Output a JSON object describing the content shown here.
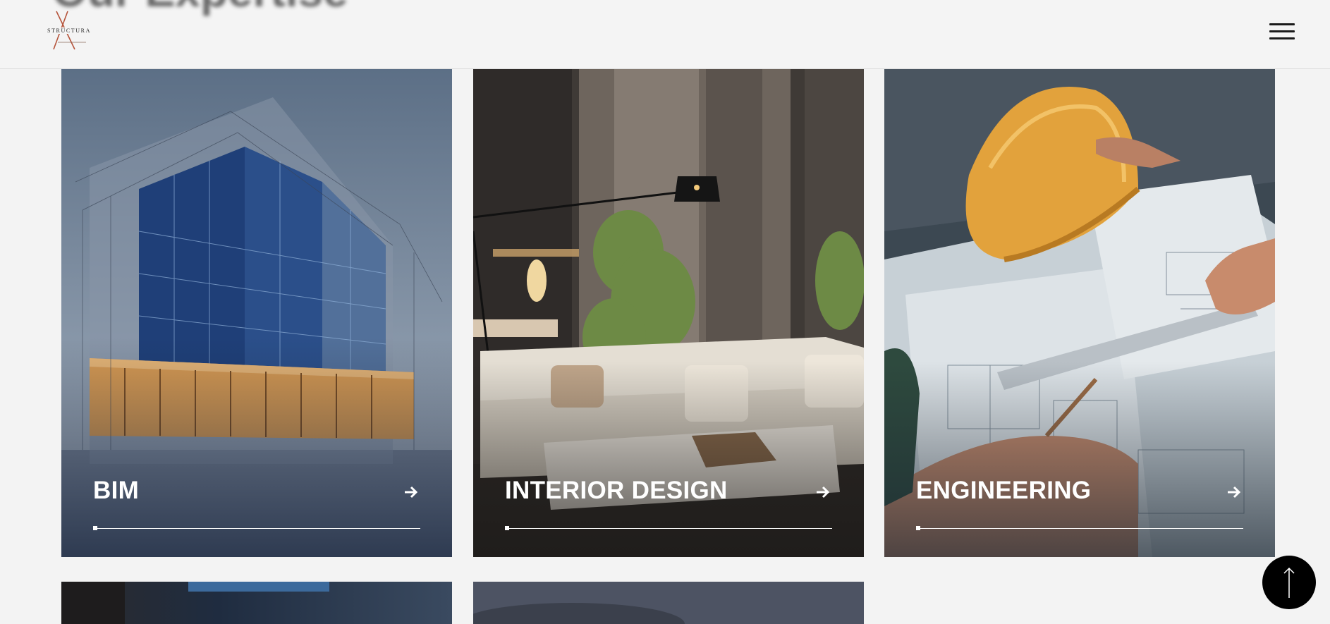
{
  "header": {
    "ghost_heading": "Our Expertise",
    "logo_text": "STRUCTURA",
    "menu_icon": "hamburger-icon"
  },
  "cards": [
    {
      "title": "BIM",
      "icon": "arrow-right-icon",
      "image": "building-wireframe-photo"
    },
    {
      "title": "INTERIOR DESIGN",
      "icon": "arrow-right-icon",
      "image": "living-room-photo"
    },
    {
      "title": "ENGINEERING",
      "icon": "arrow-right-icon",
      "image": "blueprint-hardhat-photo"
    }
  ],
  "partial_cards": [
    {
      "image": "architecture-photo"
    },
    {
      "image": "skyline-photo"
    }
  ],
  "scroll_top": {
    "icon": "arrow-up-icon"
  },
  "colors": {
    "page_bg": "#f3f3f3",
    "header_bg": "#f4f4f4",
    "card_text": "#ffffff",
    "scroll_button": "#000000",
    "logo_accent": "#b5533a"
  }
}
